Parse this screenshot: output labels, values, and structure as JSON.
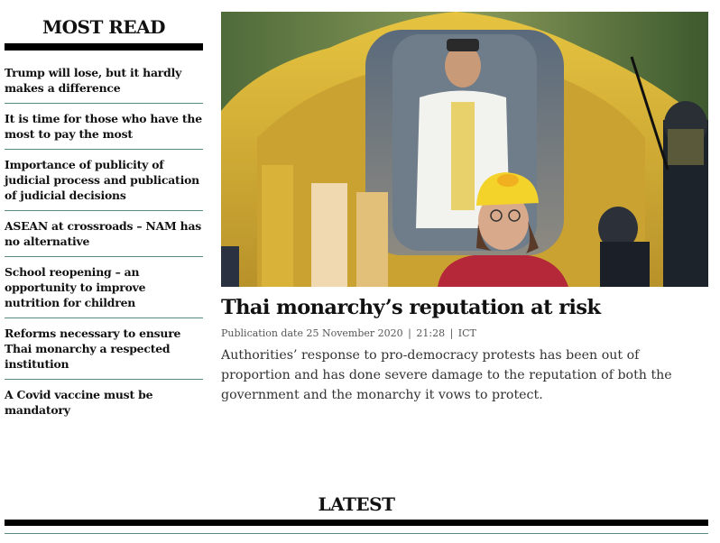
{
  "most_read": {
    "title": "MOST READ",
    "items": [
      {
        "label": "Trump will lose, but it hardly makes a difference"
      },
      {
        "label": "It is time for those who have the most to pay the most"
      },
      {
        "label": "Importance of publicity of judicial process and publication of judicial decisions"
      },
      {
        "label": "ASEAN at crossroads – NAM has no alternative"
      },
      {
        "label": "School reopening – an opportunity to improve nutrition for children"
      },
      {
        "label": "Reforms necessary to ensure Thai monarchy a respected institution"
      },
      {
        "label": "A Covid vaccine must be mandatory"
      }
    ]
  },
  "article": {
    "headline": "Thai monarchy’s reputation at risk",
    "pub_prefix": "Publication date",
    "pub_date": "25 November 2020",
    "pub_time": "21:28",
    "pub_tz": "ICT",
    "summary": "Authorities’ response to pro-democracy protests has been out of proportion and has done severe damage to the reputation of both the government and the monarchy it vows to protect."
  },
  "latest": {
    "title": "LATEST"
  }
}
